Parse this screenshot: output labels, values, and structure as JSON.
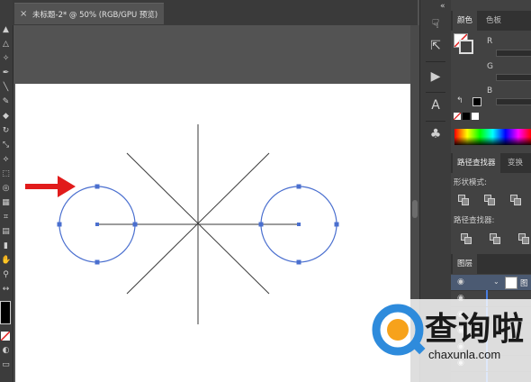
{
  "document": {
    "tab_close": "×",
    "tab_title": "未标题-2* @ 50% (RGB/GPU 预览)"
  },
  "toolbar": {
    "tools": [
      "selection-tool",
      "direct-selection-tool",
      "pen-tool",
      "type-tool",
      "line-tool",
      "brush-tool",
      "eraser-tool",
      "rotate-tool",
      "scale-tool",
      "width-tool",
      "free-transform-tool",
      "shape-builder-tool",
      "perspective-tool",
      "mesh-tool",
      "gradient-tool",
      "eyedropper-tool",
      "blend-tool",
      "symbol-sprayer-tool",
      "column-graph-tool",
      "artboard-tool",
      "slice-tool",
      "hand-tool",
      "zoom-tool"
    ],
    "fill_color": "#000000",
    "stroke_color": "#ffffff"
  },
  "canvas": {
    "annotation_arrow_color": "#e11b1b",
    "circle_stroke_color": "#4a6fcf",
    "line_color": "#333333",
    "artboard_color": "#ffffff"
  },
  "panels": {
    "collapse_glyph": "«",
    "color": {
      "tabs": [
        "颜色",
        "色板"
      ],
      "channels": [
        "R",
        "G",
        "B"
      ],
      "spectrum": "rainbow"
    },
    "pathfinder": {
      "tabs": [
        "路径查找器",
        "变换"
      ],
      "shape_modes_label": "形状模式:",
      "pathfinders_label": "路径查找器:"
    },
    "layers": {
      "tab": "图层",
      "row_label": "图"
    }
  },
  "watermark": {
    "title": "查询啦",
    "url": "chaxunla.com",
    "brand_color": "#2e8bdc"
  }
}
